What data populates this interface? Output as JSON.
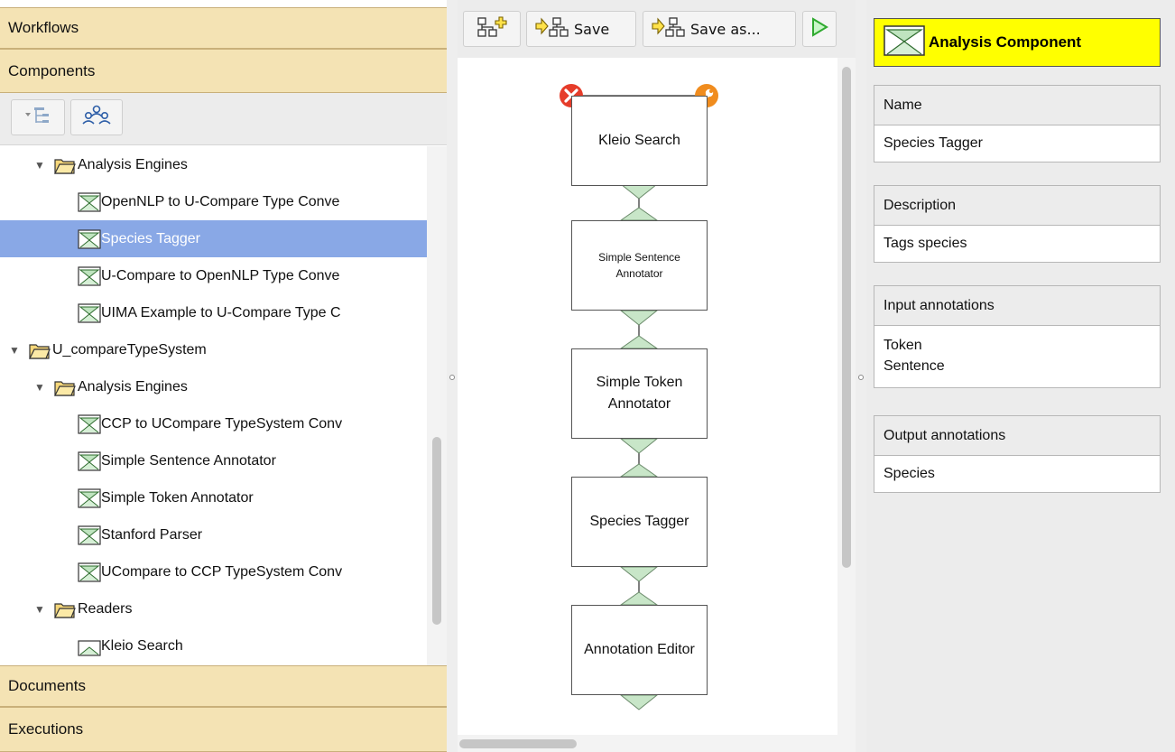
{
  "left_panel": {
    "sections": {
      "workflows": "Workflows",
      "components": "Components",
      "documents": "Documents",
      "executions": "Executions"
    },
    "tree": [
      {
        "label": "Analysis Engines",
        "kind": "folder"
      },
      {
        "label": "OpenNLP to U-Compare Type Conve",
        "kind": "component"
      },
      {
        "label": "Species Tagger",
        "kind": "component",
        "selected": true
      },
      {
        "label": "U-Compare to OpenNLP Type Conve",
        "kind": "component"
      },
      {
        "label": "UIMA Example to U-Compare Type C",
        "kind": "component"
      },
      {
        "label": "U_compareTypeSystem",
        "kind": "folder"
      },
      {
        "label": "Analysis Engines",
        "kind": "folder"
      },
      {
        "label": "CCP to UCompare TypeSystem Conv",
        "kind": "component"
      },
      {
        "label": "Simple Sentence Annotator",
        "kind": "component"
      },
      {
        "label": "Simple Token Annotator",
        "kind": "component"
      },
      {
        "label": "Stanford Parser",
        "kind": "component"
      },
      {
        "label": "UCompare to CCP TypeSystem Conv",
        "kind": "component"
      },
      {
        "label": "Readers",
        "kind": "folder"
      },
      {
        "label": "Kleio Search",
        "kind": "reader"
      }
    ]
  },
  "workflow_toolbar": {
    "save": "Save",
    "save_as": "Save as..."
  },
  "workflow": {
    "nodes": [
      {
        "label": "Kleio Search"
      },
      {
        "label": "Simple Sentence Annotator"
      },
      {
        "label": "Simple Token Annotator"
      },
      {
        "label": "Species Tagger"
      },
      {
        "label": "Annotation Editor"
      }
    ]
  },
  "properties": {
    "type": "Analysis Component",
    "name_title": "Name",
    "name_value": "Species Tagger",
    "description_title": "Description",
    "description_value": "Tags species",
    "input_title": "Input annotations",
    "input_values": [
      "Token",
      "Sentence"
    ],
    "output_title": "Output annotations",
    "output_values": [
      "Species"
    ]
  },
  "colors": {
    "accordion_header": "#f4e3b4",
    "selection": "#89a8e6",
    "component_type_bg": "#ffff00",
    "port_green": "#c8e6c8",
    "remove_red": "#e63c2a",
    "configure_orange": "#f08c1e",
    "run_green": "#33cc33"
  },
  "icons": {
    "tree_expand": "tree-view-icon",
    "group": "group-icon",
    "add_component": "add-component-icon",
    "save": "save-workflow-icon",
    "save_as": "save-as-workflow-icon",
    "run": "run-icon",
    "remove": "remove-icon",
    "configure": "wrench-icon",
    "component": "analysis-component-icon",
    "folder": "folder-icon"
  }
}
